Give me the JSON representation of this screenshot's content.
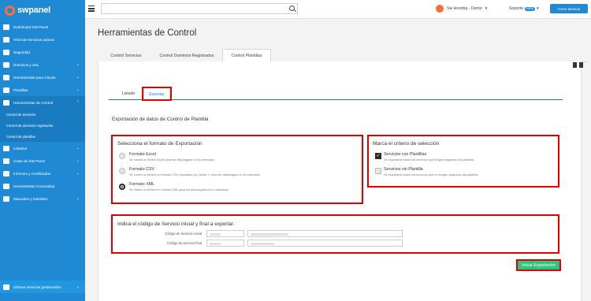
{
  "brand": {
    "name": "swpanel"
  },
  "sidebar": {
    "items": [
      {
        "label": "Dashboard SW Panel",
        "chevron": false
      },
      {
        "label": "Árbol de servicios activos",
        "chevron": false
      },
      {
        "label": "Seguridad",
        "chevron": false
      },
      {
        "label": "Dominios y SSL",
        "chevron": true
      },
      {
        "label": "Herramientas para Clouds",
        "chevron": true
      },
      {
        "label": "Plantillas",
        "chevron": true
      },
      {
        "label": "Herramientas de Control",
        "chevron": true,
        "active": true
      }
    ],
    "subitems": [
      {
        "label": "Control de Servicios"
      },
      {
        "label": "Control de dominios registrados"
      },
      {
        "label": "Control de plantillas"
      }
    ],
    "items_after": [
      {
        "label": "Listados",
        "chevron": true
      },
      {
        "label": "Colas de SW Panel",
        "chevron": true
      },
      {
        "label": "Informes y Certificados",
        "chevron": true
      },
      {
        "label": "Herramientas Comunidad",
        "chevron": false
      },
      {
        "label": "Manuales y tutoriales",
        "chevron": true
      }
    ],
    "bottom": {
      "label": "Últimos servicios gestionados"
    }
  },
  "topbar": {
    "search_placeholder": "",
    "account_name": "Sw Hosting - Demo",
    "support_label": "Soporte",
    "support_badge": "NEW",
    "new_service_label": "Crear servicio"
  },
  "page": {
    "title": "Herramientas de Control",
    "tabs": [
      {
        "label": "Control Servicios"
      },
      {
        "label": "Control Dominios Registrados"
      },
      {
        "label": "Control Plantillas",
        "active": true
      }
    ],
    "subtabs": [
      {
        "label": "Listado"
      },
      {
        "label": "Exportar",
        "active": true
      }
    ],
    "section_title": "Exportación de datos de Control de Plantilla",
    "format_box": {
      "title": "Selecciona el formato de Exportación",
      "options": [
        {
          "label": "Formato Excel",
          "help": "Se creara un fichero Excel para ser descargado en tu ordenador.",
          "checked": false
        },
        {
          "label": "Formato CSV",
          "help": "Se creara un fichero en formato CSV (separado por 'punto Y' para ser descargado en tu ordenador.",
          "checked": false
        },
        {
          "label": "Formato XML",
          "help": "Se creara un fichero en formato XML para ser descargado en tu ordenador.",
          "checked": true
        }
      ]
    },
    "criteria_box": {
      "title": "Marca el criterio de selección",
      "options": [
        {
          "label": "Servicios con Plantillas",
          "help": "Se exportarán todos los servicios que tengan asignada una plantilla.",
          "checked": true
        },
        {
          "label": "Servicios sin Plantilla",
          "help": "Se exportarán todos los servicios que no tengan asignada una plantilla.",
          "checked": false
        }
      ]
    },
    "range_box": {
      "title": "Indica el código de Servicio inicial y final a exportar.",
      "fields": [
        {
          "label": "Código de Servicio inicial"
        },
        {
          "label": "Código de Servicio final"
        }
      ]
    },
    "export_button": "Iniciar Exportación"
  },
  "colors": {
    "sidebar": "#1f8ad3",
    "accent": "#1f8ad3",
    "highlight": "#e00000",
    "export_button": "#2dc47f"
  }
}
